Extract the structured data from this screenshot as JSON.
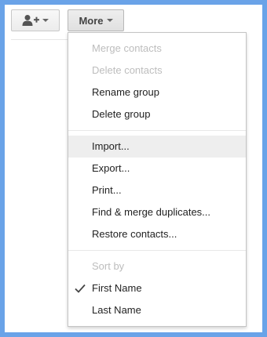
{
  "toolbar": {
    "add_contact_icon": "person-add-icon",
    "more_label": "More"
  },
  "menu": {
    "group1": [
      {
        "label": "Merge contacts",
        "enabled": false
      },
      {
        "label": "Delete contacts",
        "enabled": false
      },
      {
        "label": "Rename group",
        "enabled": true
      },
      {
        "label": "Delete group",
        "enabled": true
      }
    ],
    "group2": [
      {
        "label": "Import...",
        "enabled": true,
        "highlighted": true
      },
      {
        "label": "Export...",
        "enabled": true
      },
      {
        "label": "Print...",
        "enabled": true
      },
      {
        "label": "Find & merge duplicates...",
        "enabled": true
      },
      {
        "label": "Restore contacts...",
        "enabled": true
      }
    ],
    "sort_header": "Sort by",
    "sort_options": [
      {
        "label": "First Name",
        "selected": true
      },
      {
        "label": "Last Name",
        "selected": false
      }
    ]
  },
  "colors": {
    "frame": "#6aa3e8",
    "disabled_text": "#bdbdbd",
    "hover_bg": "#eeeeee"
  }
}
